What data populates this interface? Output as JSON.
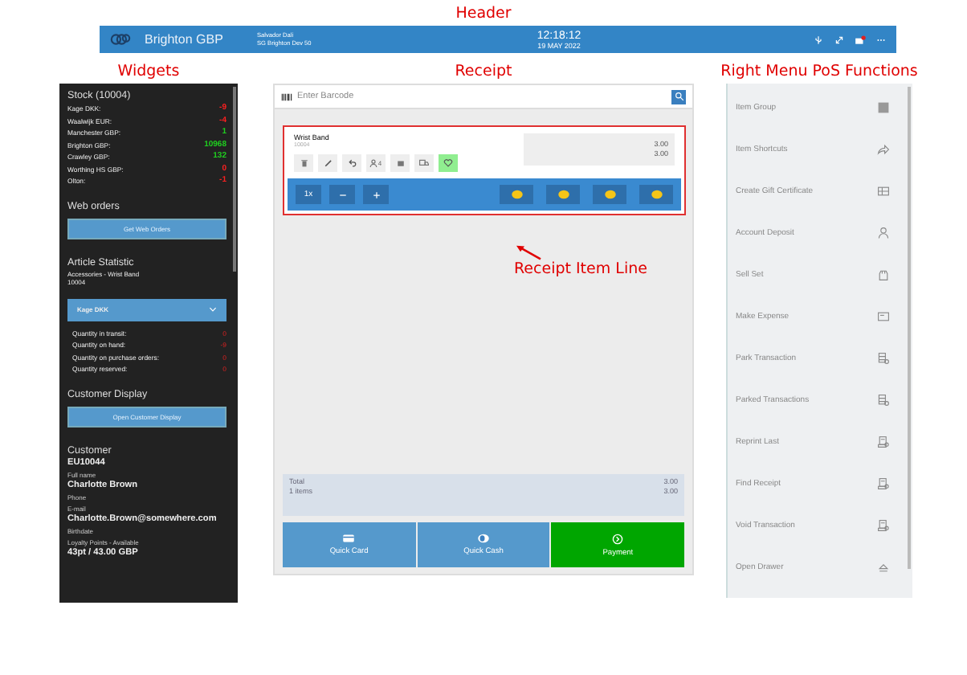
{
  "annotations": {
    "header": "Header",
    "widgets": "Widgets",
    "receipt": "Receipt",
    "right_menu": "Right Menu PoS Functions",
    "item_line": "Receipt Item Line"
  },
  "header": {
    "store": "Brighton GBP",
    "user": "Salvador Dali",
    "terminal": "SG Brighton Dev 50",
    "time": "12:18:12",
    "date": "19 MAY 2022",
    "mail_unread": true
  },
  "stock": {
    "title": "Stock (10004)",
    "rows": [
      {
        "store": "Kage DKK:",
        "qty": "-9",
        "kind": "short"
      },
      {
        "store": "Waalwijk EUR:",
        "qty": "-4",
        "kind": "short"
      },
      {
        "store": "Manchester GBP:",
        "qty": "1",
        "kind": "available"
      },
      {
        "store": "Brighton GBP:",
        "qty": "10968",
        "kind": "available"
      },
      {
        "store": "Crawley GBP:",
        "qty": "132",
        "kind": "available"
      },
      {
        "store": "Worthing HS GBP:",
        "qty": "0",
        "kind": "short"
      },
      {
        "store": "Olton:",
        "qty": "-1",
        "kind": "short"
      }
    ]
  },
  "web_orders": {
    "title": "Web orders",
    "button": "Get Web Orders"
  },
  "article_statistic": {
    "title": "Article Statistic",
    "article": "Accessories - Wrist Band",
    "number": "10004",
    "store_select": "Kage DKK",
    "rows": [
      {
        "label": "Quantity in transit:",
        "value": "0"
      },
      {
        "label": "Quantity on hand:",
        "value": "-9"
      },
      {
        "label": "Quantity on purchase orders:",
        "value": "0"
      },
      {
        "label": "Quantity reserved:",
        "value": "0"
      }
    ]
  },
  "customer_display": {
    "title": "Customer Display",
    "button": "Open Customer Display"
  },
  "customer": {
    "title": "Customer",
    "id": "EU10044",
    "fields": [
      {
        "label": "Full name",
        "value": "Charlotte Brown"
      },
      {
        "label": "Phone"
      },
      {
        "label": "E-mail",
        "value": "Charlotte.Brown@somewhere.com"
      },
      {
        "label": "Birthdate"
      },
      {
        "label": "Loyalty Points - Available",
        "value": "43pt / 43.00 GBP"
      }
    ]
  },
  "receipt": {
    "barcode_placeholder": "Enter Barcode",
    "line": {
      "name": "Wrist Band",
      "number": "10004",
      "price": "3.00",
      "total": "3.00",
      "salesperson_count": "4",
      "favorite": true,
      "quantity": "1x"
    },
    "total": {
      "label": "Total",
      "items": "1 items",
      "amount": "3.00",
      "amount_due": "3.00"
    },
    "actions": [
      {
        "kind": "card",
        "label": "Quick Card"
      },
      {
        "kind": "cash",
        "label": "Quick Cash"
      },
      {
        "kind": "payment",
        "label": "Payment"
      }
    ]
  },
  "right_menu": [
    {
      "label": "Item Group"
    },
    {
      "label": "Item Shortcuts"
    },
    {
      "label": "Create Gift Certificate"
    },
    {
      "label": "Account Deposit"
    },
    {
      "label": "Sell Set"
    },
    {
      "label": "Make Expense"
    },
    {
      "label": "Park Transaction"
    },
    {
      "label": "Parked Transactions"
    },
    {
      "label": "Reprint Last"
    },
    {
      "label": "Find Receipt"
    },
    {
      "label": "Void Transaction"
    },
    {
      "label": "Open Drawer"
    }
  ]
}
